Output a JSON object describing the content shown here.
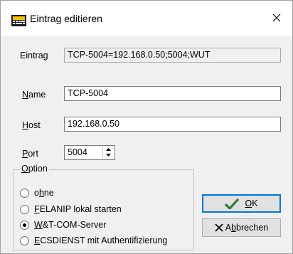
{
  "window": {
    "title": "Eintrag editieren",
    "close_glyph": "✕",
    "icon": "keyboard-app-icon"
  },
  "entry": {
    "label": "Eintrag",
    "value": "TCP-5004=192.168.0.50;5004;WUT"
  },
  "name": {
    "label_mnemonic": "N",
    "label_rest": "ame",
    "value": "TCP-5004"
  },
  "host": {
    "label_mnemonic": "H",
    "label_rest": "ost",
    "value": "192.168.0.50"
  },
  "port": {
    "label_mnemonic": "P",
    "label_rest": "ort",
    "value": "5004"
  },
  "option": {
    "legend_mnemonic": "O",
    "legend_rest": "ption",
    "items": [
      {
        "pre": "o",
        "mnemonic": "h",
        "post": "ne",
        "checked": false
      },
      {
        "pre": "",
        "mnemonic": "F",
        "post": "ELANIP lokal starten",
        "checked": false
      },
      {
        "pre": "",
        "mnemonic": "W",
        "post": "&T-COM-Server",
        "checked": true
      },
      {
        "pre": "",
        "mnemonic": "E",
        "post": "CSDIENST mit Authentifizierung",
        "checked": false
      }
    ]
  },
  "buttons": {
    "ok": {
      "pre": "",
      "mnemonic": "O",
      "post": "K",
      "icon": "checkmark-icon",
      "icon_color": "#2e7d32"
    },
    "cancel": {
      "pre": "A",
      "mnemonic": "b",
      "post": "brechen",
      "icon": "x-cross-icon"
    }
  }
}
